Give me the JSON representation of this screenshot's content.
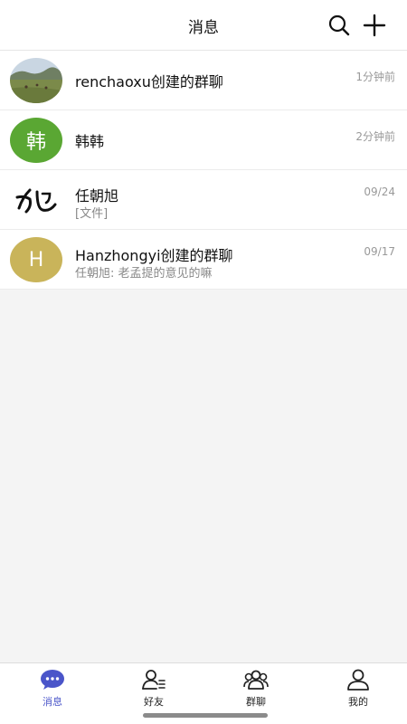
{
  "header": {
    "title": "消息"
  },
  "conversations": [
    {
      "title": "renchaoxu创建的群聊",
      "subtitle": "",
      "time": "1分钟前",
      "avatar_type": "photo"
    },
    {
      "title": "韩韩",
      "subtitle": "",
      "time": "2分钟前",
      "avatar_type": "letter",
      "avatar_text": "韩",
      "avatar_color": "#5aa733"
    },
    {
      "title": "任朝旭",
      "subtitle": "[文件]",
      "time": "09/24",
      "avatar_type": "calligraphy",
      "avatar_text": "旭"
    },
    {
      "title": "Hanzhongyi创建的群聊",
      "subtitle": "任朝旭: 老孟提的意见的嘛",
      "time": "09/17",
      "avatar_type": "letter",
      "avatar_text": "H",
      "avatar_color": "#c9b45a"
    }
  ],
  "tabs": [
    {
      "label": "消息",
      "icon": "chat-bubble-icon",
      "active": true
    },
    {
      "label": "好友",
      "icon": "friends-icon",
      "active": false
    },
    {
      "label": "群聊",
      "icon": "group-icon",
      "active": false
    },
    {
      "label": "我的",
      "icon": "person-icon",
      "active": false
    }
  ],
  "colors": {
    "accent": "#4a55c9",
    "background": "#f4f4f4"
  }
}
